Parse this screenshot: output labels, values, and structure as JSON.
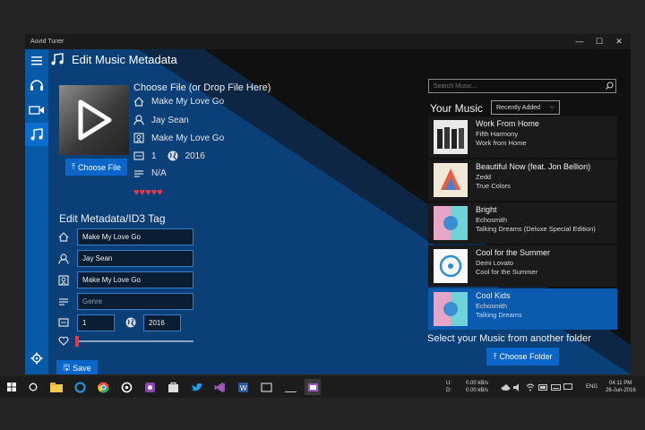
{
  "window": {
    "title": "Auvid Tuner",
    "minimize": "—",
    "maximize": "☐",
    "close": "✕"
  },
  "app": {
    "heading": "Edit Music Metadata"
  },
  "nav": {
    "items": [
      "menu-icon",
      "headphones-icon",
      "video-icon",
      "music-notes-icon"
    ],
    "selected": "music-notes-icon",
    "settings": "gear-icon"
  },
  "file": {
    "choose_title": "Choose File (or Drop File Here)",
    "choose_button": "Choose File",
    "title": "Make My Love Go",
    "artist": "Jay Sean",
    "album": "Make My Love Go",
    "track": "1",
    "year": "2016",
    "genre": "N/A",
    "rating": 5,
    "hearts": "♥♥♥♥♥"
  },
  "editor": {
    "section_title": "Edit Metadata/ID3 Tag",
    "title_value": "Make My Love Go",
    "artist_value": "Jay Sean",
    "album_value": "Make My Love Go",
    "genre_value": "",
    "genre_placeholder": "Genre",
    "track_value": "1",
    "year_value": "2016",
    "rating_value": 0,
    "save_label": "Save"
  },
  "library": {
    "search_placeholder": "Search Music...",
    "heading": "Your Music",
    "sort_label": "Recently Added",
    "items": [
      {
        "title": "Work From Home",
        "artist": "Fifth Harmony",
        "album": "Work from Home"
      },
      {
        "title": "Beautiful Now (feat. Jon Bellion)",
        "artist": "Zedd",
        "album": "True Colors"
      },
      {
        "title": "Bright",
        "artist": "Echosmith",
        "album": "Talking Dreams (Deluxe Special Edition)"
      },
      {
        "title": "Cool for the Summer",
        "artist": "Demi Lovato",
        "album": "Cool for the Summer"
      },
      {
        "title": "Cool Kids",
        "artist": "Echosmith",
        "album": "Talking Dreams"
      }
    ],
    "selected_index": 4,
    "select_folder_text": "Select your Music from another folder",
    "choose_folder": "Choose Folder"
  },
  "taskbar": {
    "network_up": "0.00 kB/s",
    "network_down": "0.00 kB/s",
    "network_label_u": "U:",
    "network_label_d": "D:",
    "language": "ENG",
    "time": "04:11 PM",
    "date": "26-Jun-2016"
  },
  "colors": {
    "accent": "#0a66c8",
    "nav": "#075aa8",
    "heart": "#e63946"
  }
}
